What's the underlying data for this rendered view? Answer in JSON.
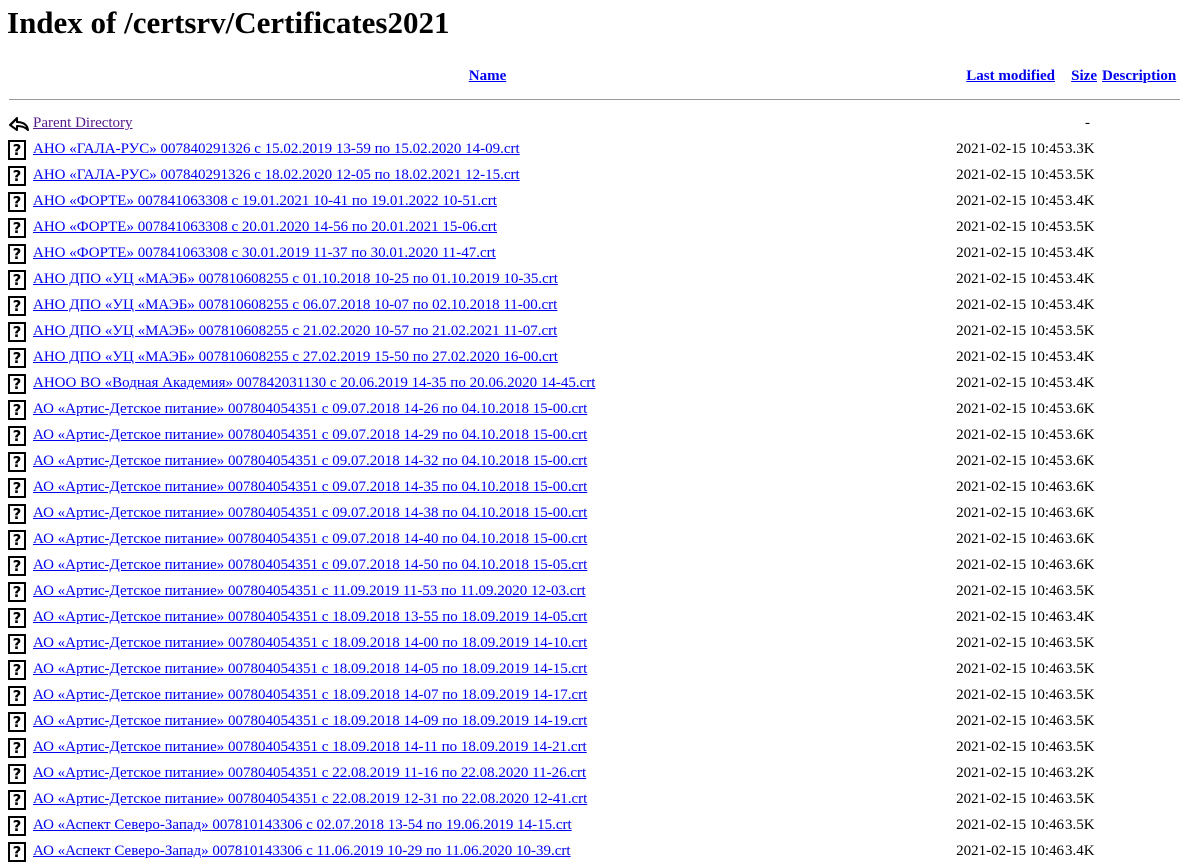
{
  "page_title": "Index of /certsrv/Certificates2021",
  "header": {
    "name": "Name",
    "last_modified": "Last modified",
    "size": "Size",
    "description": "Description"
  },
  "parent": {
    "label": "Parent Directory",
    "size": "-"
  },
  "files": [
    {
      "name": "АНО «ГАЛА-РУС» 007840291326 с 15.02.2019 13-59 по 15.02.2020 14-09.crt",
      "modified": "2021-02-15 10:45",
      "size": "3.3K"
    },
    {
      "name": "АНО «ГАЛА-РУС» 007840291326 с 18.02.2020 12-05 по 18.02.2021 12-15.crt",
      "modified": "2021-02-15 10:45",
      "size": "3.5K"
    },
    {
      "name": "АНО «ФОРТЕ» 007841063308 с 19.01.2021 10-41 по 19.01.2022 10-51.crt",
      "modified": "2021-02-15 10:45",
      "size": "3.4K"
    },
    {
      "name": "АНО «ФОРТЕ» 007841063308 с 20.01.2020 14-56 по 20.01.2021 15-06.crt",
      "modified": "2021-02-15 10:45",
      "size": "3.5K"
    },
    {
      "name": "АНО «ФОРТЕ» 007841063308 с 30.01.2019 11-37 по 30.01.2020 11-47.crt",
      "modified": "2021-02-15 10:45",
      "size": "3.4K"
    },
    {
      "name": "АНО ДПО «УЦ «МАЭБ» 007810608255 с 01.10.2018 10-25 по 01.10.2019 10-35.crt",
      "modified": "2021-02-15 10:45",
      "size": "3.4K"
    },
    {
      "name": "АНО ДПО «УЦ «МАЭБ» 007810608255 с 06.07.2018 10-07 по 02.10.2018 11-00.crt",
      "modified": "2021-02-15 10:45",
      "size": "3.4K"
    },
    {
      "name": "АНО ДПО «УЦ «МАЭБ» 007810608255 с 21.02.2020 10-57 по 21.02.2021 11-07.crt",
      "modified": "2021-02-15 10:45",
      "size": "3.5K"
    },
    {
      "name": "АНО ДПО «УЦ «МАЭБ» 007810608255 с 27.02.2019 15-50 по 27.02.2020 16-00.crt",
      "modified": "2021-02-15 10:45",
      "size": "3.4K"
    },
    {
      "name": "АНОО ВО «Водная Академия» 007842031130 с 20.06.2019 14-35 по 20.06.2020 14-45.crt",
      "modified": "2021-02-15 10:45",
      "size": "3.4K"
    },
    {
      "name": "АО «Артис-Детское питание» 007804054351 с 09.07.2018 14-26 по 04.10.2018 15-00.crt",
      "modified": "2021-02-15 10:45",
      "size": "3.6K"
    },
    {
      "name": "АО «Артис-Детское питание» 007804054351 с 09.07.2018 14-29 по 04.10.2018 15-00.crt",
      "modified": "2021-02-15 10:45",
      "size": "3.6K"
    },
    {
      "name": "АО «Артис-Детское питание» 007804054351 с 09.07.2018 14-32 по 04.10.2018 15-00.crt",
      "modified": "2021-02-15 10:45",
      "size": "3.6K"
    },
    {
      "name": "АО «Артис-Детское питание» 007804054351 с 09.07.2018 14-35 по 04.10.2018 15-00.crt",
      "modified": "2021-02-15 10:46",
      "size": "3.6K"
    },
    {
      "name": "АО «Артис-Детское питание» 007804054351 с 09.07.2018 14-38 по 04.10.2018 15-00.crt",
      "modified": "2021-02-15 10:46",
      "size": "3.6K"
    },
    {
      "name": "АО «Артис-Детское питание» 007804054351 с 09.07.2018 14-40 по 04.10.2018 15-00.crt",
      "modified": "2021-02-15 10:46",
      "size": "3.6K"
    },
    {
      "name": "АО «Артис-Детское питание» 007804054351 с 09.07.2018 14-50 по 04.10.2018 15-05.crt",
      "modified": "2021-02-15 10:46",
      "size": "3.6K"
    },
    {
      "name": "АО «Артис-Детское питание» 007804054351 с 11.09.2019 11-53 по 11.09.2020 12-03.crt",
      "modified": "2021-02-15 10:46",
      "size": "3.5K"
    },
    {
      "name": "АО «Артис-Детское питание» 007804054351 с 18.09.2018 13-55 по 18.09.2019 14-05.crt",
      "modified": "2021-02-15 10:46",
      "size": "3.4K"
    },
    {
      "name": "АО «Артис-Детское питание» 007804054351 с 18.09.2018 14-00 по 18.09.2019 14-10.crt",
      "modified": "2021-02-15 10:46",
      "size": "3.5K"
    },
    {
      "name": "АО «Артис-Детское питание» 007804054351 с 18.09.2018 14-05 по 18.09.2019 14-15.crt",
      "modified": "2021-02-15 10:46",
      "size": "3.5K"
    },
    {
      "name": "АО «Артис-Детское питание» 007804054351 с 18.09.2018 14-07 по 18.09.2019 14-17.crt",
      "modified": "2021-02-15 10:46",
      "size": "3.5K"
    },
    {
      "name": "АО «Артис-Детское питание» 007804054351 с 18.09.2018 14-09 по 18.09.2019 14-19.crt",
      "modified": "2021-02-15 10:46",
      "size": "3.5K"
    },
    {
      "name": "АО «Артис-Детское питание» 007804054351 с 18.09.2018 14-11 по 18.09.2019 14-21.crt",
      "modified": "2021-02-15 10:46",
      "size": "3.5K"
    },
    {
      "name": "АО «Артис-Детское питание» 007804054351 с 22.08.2019 11-16 по 22.08.2020 11-26.crt",
      "modified": "2021-02-15 10:46",
      "size": "3.2K"
    },
    {
      "name": "АО «Артис-Детское питание» 007804054351 с 22.08.2019 12-31 по 22.08.2020 12-41.crt",
      "modified": "2021-02-15 10:46",
      "size": "3.5K"
    },
    {
      "name": "АО «Аспект Северо-Запад» 007810143306 с 02.07.2018 13-54 по 19.06.2019 14-15.crt",
      "modified": "2021-02-15 10:46",
      "size": "3.5K"
    },
    {
      "name": "АО «Аспект Северо-Запад» 007810143306 с 11.06.2019 10-29 по 11.06.2020 10-39.crt",
      "modified": "2021-02-15 10:46",
      "size": "3.4K"
    }
  ]
}
